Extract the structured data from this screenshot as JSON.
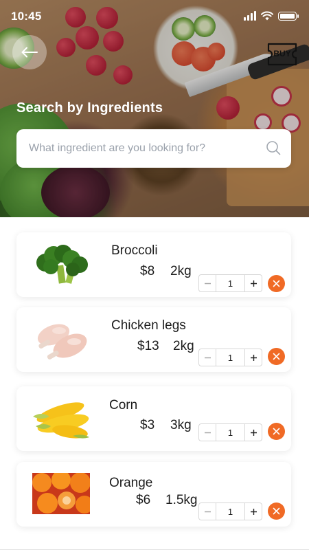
{
  "status_bar": {
    "time": "10:45"
  },
  "header": {
    "title": "Search by Ingredients",
    "buy_label": "BUY"
  },
  "search": {
    "placeholder": "What ingredient are you looking for?",
    "value": ""
  },
  "items": [
    {
      "name": "Broccoli",
      "price": "$8",
      "weight": "2kg",
      "quantity": "1",
      "image": "broccoli"
    },
    {
      "name": "Chicken legs",
      "price": "$13",
      "weight": "2kg",
      "quantity": "1",
      "image": "chicken-legs"
    },
    {
      "name": "Corn",
      "price": "$3",
      "weight": "3kg",
      "quantity": "1",
      "image": "corn"
    },
    {
      "name": "Orange",
      "price": "$6",
      "weight": "1.5kg",
      "quantity": "1",
      "image": "orange"
    }
  ],
  "icons": {
    "back": "arrow-left-icon",
    "buy": "buy-ticket-icon",
    "search": "search-icon",
    "remove": "close-icon",
    "minus": "minus-icon",
    "plus": "plus-icon"
  },
  "colors": {
    "accent": "#f06a25",
    "text": "#1c1c1c",
    "placeholder": "#9aa1ab"
  }
}
